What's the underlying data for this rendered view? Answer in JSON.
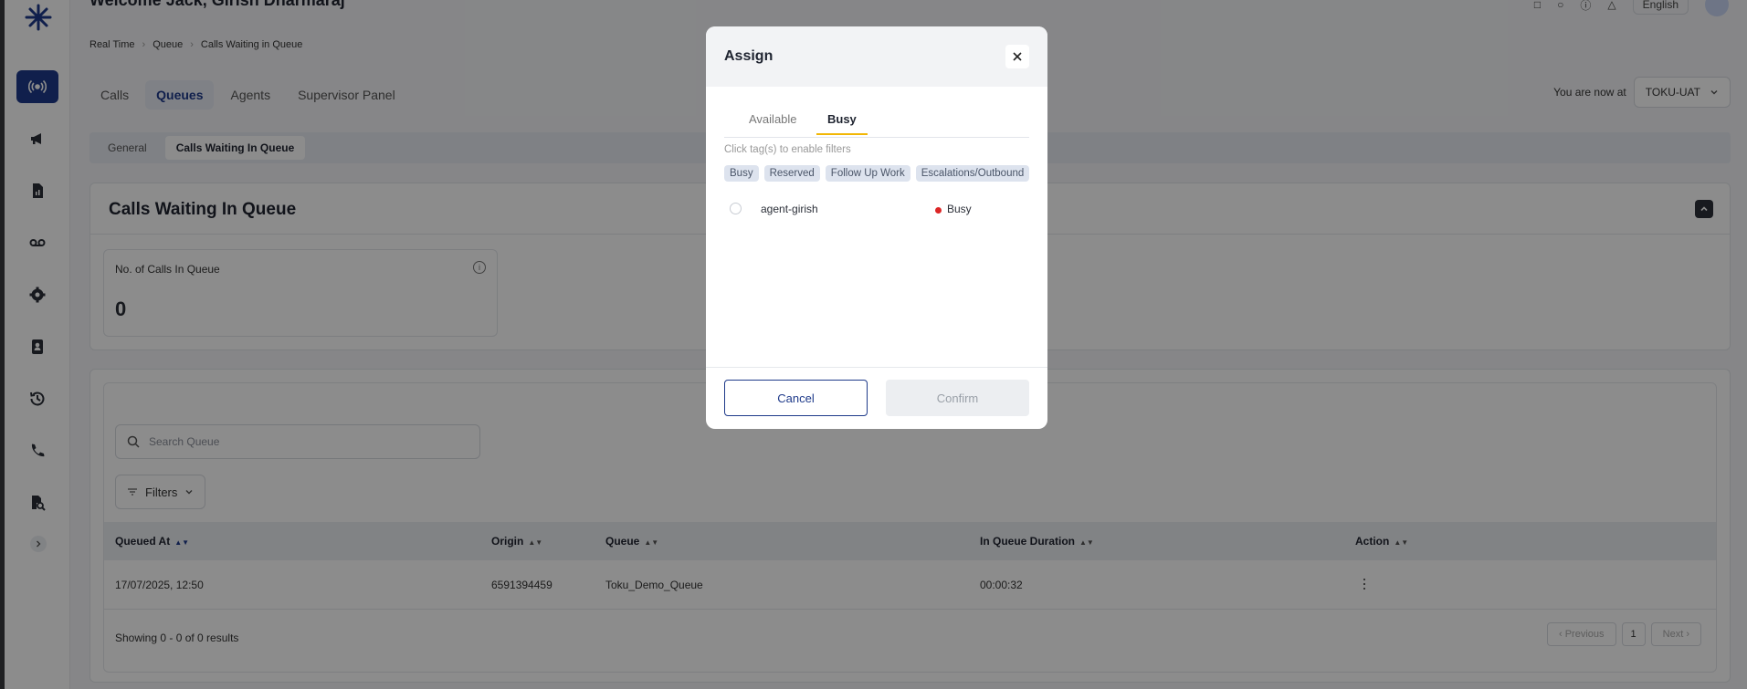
{
  "header": {
    "title": "Welcome Jack, Girish Dharmaraj",
    "language": "English"
  },
  "breadcrumb": [
    "Real Time",
    "Queue",
    "Calls Waiting in Queue"
  ],
  "main_tabs": [
    "Calls",
    "Queues",
    "Agents",
    "Supervisor Panel"
  ],
  "location": {
    "label": "You are now at",
    "value": "TOKU-UAT"
  },
  "sub_tabs": [
    "General",
    "Calls Waiting In Queue"
  ],
  "summary_card": {
    "title": "Calls Waiting In Queue",
    "stat_label": "No. of Calls In Queue",
    "stat_value": "0",
    "info_icon": "i"
  },
  "table": {
    "search_placeholder": "Search Queue",
    "filters_label": "Filters",
    "columns": [
      "Queued At",
      "Origin",
      "Queue",
      "In Queue Duration",
      "Action"
    ],
    "rows": [
      {
        "queued_at": "17/07/2025, 12:50",
        "origin": "6591394459",
        "queue": "Toku_Demo_Queue",
        "duration": "00:00:32"
      }
    ],
    "results_text": "Showing 0 - 0 of 0 results",
    "pager": {
      "prev": "‹ Previous",
      "page": "1",
      "next": "Next ›"
    }
  },
  "modal": {
    "title": "Assign",
    "tabs": [
      "Available",
      "Busy"
    ],
    "active_tab": "Busy",
    "hint": "Click tag(s) to enable filters",
    "tags": [
      "Busy",
      "Reserved",
      "Follow Up Work",
      "Escalations/Outbound"
    ],
    "agents": [
      {
        "name": "agent-girish",
        "status": "Busy",
        "status_color": "#dc2626"
      }
    ],
    "cancel_label": "Cancel",
    "confirm_label": "Confirm"
  },
  "colors": {
    "brand": "#1e3a8a",
    "active_tab_underline": "#f2b705"
  }
}
